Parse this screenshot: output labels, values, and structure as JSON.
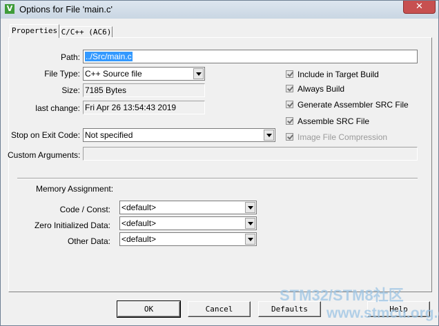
{
  "window": {
    "title": "Options for File 'main.c'",
    "icon": "V",
    "close_symbol": "✕"
  },
  "tabs": [
    {
      "label": "Properties"
    },
    {
      "label": "C/C++ (AC6)"
    }
  ],
  "path": {
    "label": "Path:",
    "value": "../Src/main.c"
  },
  "file_type": {
    "label": "File Type:",
    "value": "C++ Source file"
  },
  "size": {
    "label": "Size:",
    "value": "7185 Bytes"
  },
  "last_change": {
    "label": "last change:",
    "value": "Fri Apr 26 13:54:43 2019"
  },
  "stop_on_exit": {
    "label": "Stop on Exit Code:",
    "value": "Not specified"
  },
  "custom_args": {
    "label": "Custom Arguments:",
    "value": ""
  },
  "options": [
    {
      "label": "Include in Target Build",
      "checked": true,
      "enabled": true
    },
    {
      "label": "Always Build",
      "checked": true,
      "enabled": true
    },
    {
      "label": "Generate Assembler SRC File",
      "checked": true,
      "enabled": true
    },
    {
      "label": "Assemble SRC File",
      "checked": true,
      "enabled": true
    },
    {
      "label": "Image File Compression",
      "checked": true,
      "enabled": false
    }
  ],
  "memory": {
    "heading": "Memory Assignment:",
    "code_const": {
      "label": "Code / Const:",
      "value": "<default>"
    },
    "zero_init": {
      "label": "Zero Initialized Data:",
      "value": "<default>"
    },
    "other": {
      "label": "Other Data:",
      "value": "<default>"
    }
  },
  "buttons": {
    "ok": "OK",
    "cancel": "Cancel",
    "defaults": "Defaults",
    "help": "Help"
  },
  "watermark": {
    "line1": "STM32/STM8社区",
    "line2": "www.stmcu.org.cn"
  }
}
